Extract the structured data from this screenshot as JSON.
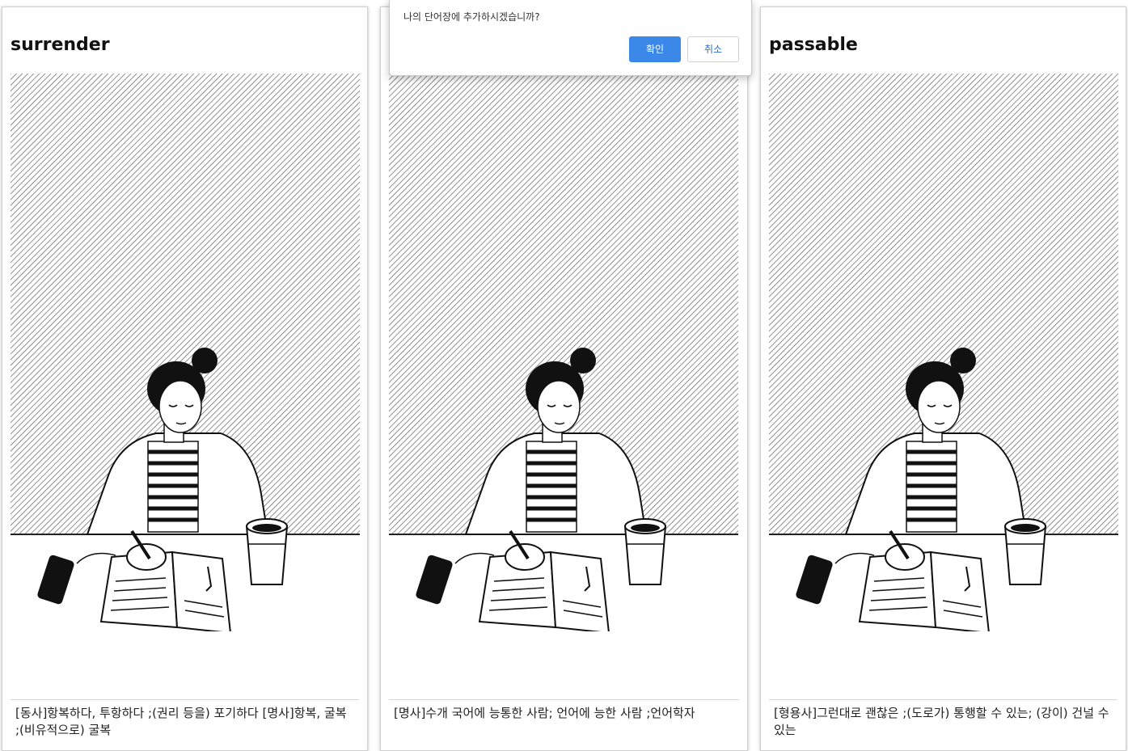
{
  "dialog": {
    "message": "나의 단어장에 추가하시겠습니까?",
    "confirm_label": "확인",
    "cancel_label": "취소"
  },
  "cards": [
    {
      "word": "surrender",
      "meaning": "[동사]항복하다, 투항하다 ;(권리 등을) 포기하다 [명사]항복, 굴복 ;(비유적으로) 굴복"
    },
    {
      "word": "",
      "meaning": "[명사]수개 국어에 능통한 사람; 언어에 능한 사람 ;언어학자"
    },
    {
      "word": "passable",
      "meaning": "[형용사]그런대로 괜찮은 ;(도로가) 통행할 수 있는; (강이) 건널 수 있는"
    }
  ],
  "colors": {
    "accent": "#3b88e8",
    "ink": "#111111"
  },
  "icons": {
    "illustration": "woman-studying-illustration"
  }
}
